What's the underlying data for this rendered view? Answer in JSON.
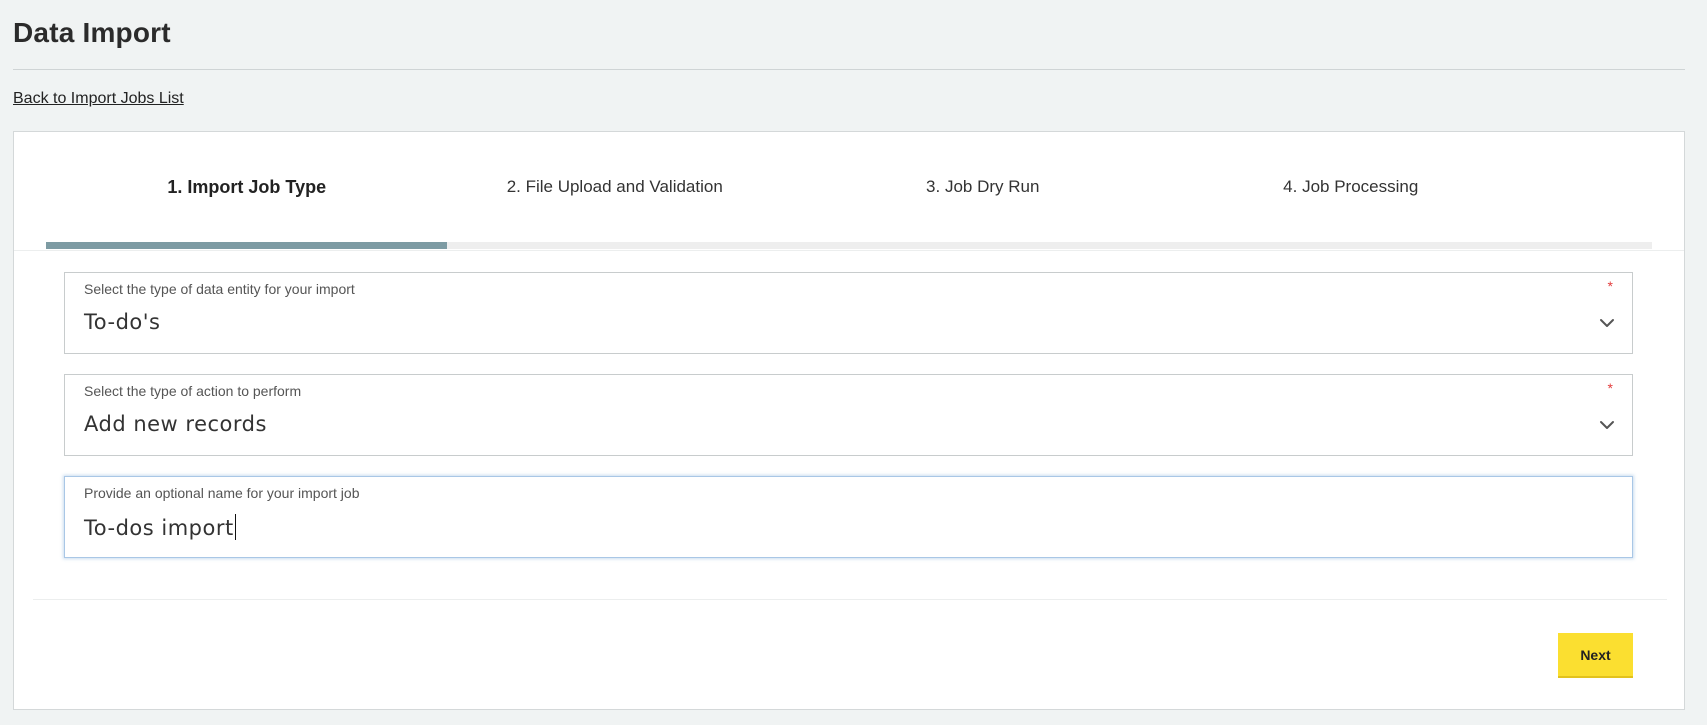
{
  "page": {
    "title": "Data Import",
    "back_link": "Back to Import Jobs List"
  },
  "stepper": {
    "steps": [
      {
        "label": "1. Import Job Type",
        "active": true
      },
      {
        "label": "2. File Upload and Validation",
        "active": false
      },
      {
        "label": "3. Job Dry Run",
        "active": false
      },
      {
        "label": "4. Job Processing",
        "active": false
      }
    ],
    "progress_fraction": 0.25
  },
  "form": {
    "entity_type": {
      "label": "Select the type of data entity for your import",
      "required_mark": "*",
      "value": "To-do's",
      "icon": "chevron-down-icon"
    },
    "action_type": {
      "label": "Select the type of action to perform",
      "required_mark": "*",
      "value": "Add new records",
      "icon": "chevron-down-icon"
    },
    "job_name": {
      "label": "Provide an optional name for your import job",
      "value": "To-dos import"
    }
  },
  "footer": {
    "next_label": "Next"
  },
  "colors": {
    "background": "#f0f3f3",
    "progress": "#7d9ba3",
    "accent_button": "#fbdf30",
    "required": "#e23b3b"
  }
}
